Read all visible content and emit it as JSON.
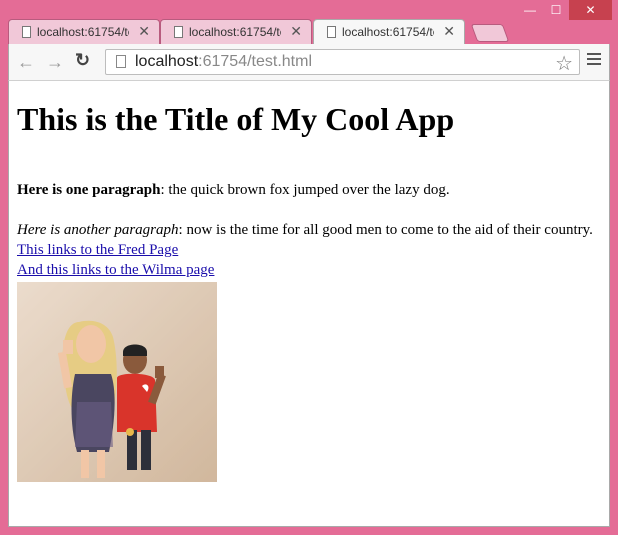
{
  "window": {
    "controls": {
      "minimize": "—",
      "maximize": "☐",
      "close": "✕"
    }
  },
  "tabs": [
    {
      "title": "localhost:61754/tes",
      "close": "✕",
      "active": false
    },
    {
      "title": "localhost:61754/tes",
      "close": "✕",
      "active": false
    },
    {
      "title": "localhost:61754/tes",
      "close": "✕",
      "active": true
    }
  ],
  "toolbar": {
    "back": "←",
    "forward": "→",
    "reload": "↻",
    "url_host": "localhost",
    "url_rest": ":61754/test.html",
    "star": "☆"
  },
  "page": {
    "title": "This is the Title of My Cool App",
    "p1_bold": "Here is one paragraph",
    "p1_rest": ": the quick brown fox jumped over the lazy dog.",
    "p2_italic": "Here is another paragraph",
    "p2_rest": ": now is the time for all good men to come to the aid of their country.",
    "link1": "This links to the Fred Page",
    "link2": "And this links to the Wilma page"
  },
  "colors": {
    "frame": "#e46c96",
    "link": "#1a0dab"
  }
}
